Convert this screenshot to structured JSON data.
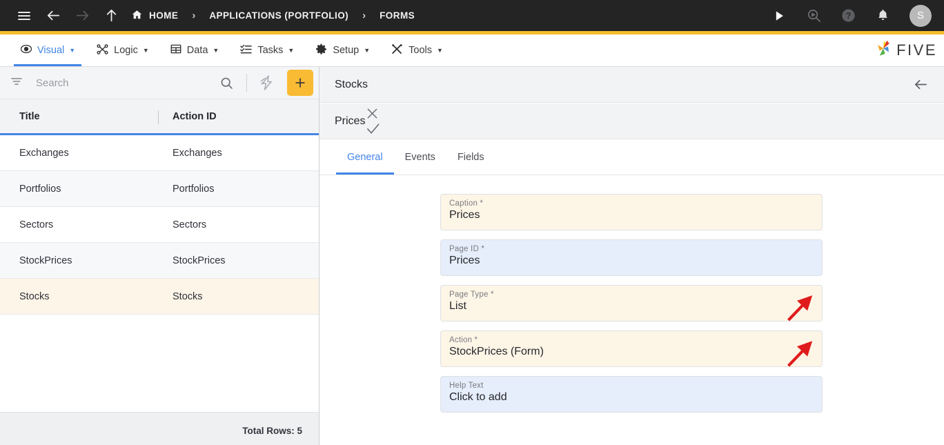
{
  "topbar": {
    "menu_icon": "hamburger-icon",
    "back_icon": "arrow-left-icon",
    "forward_icon": "arrow-right-icon",
    "up_icon": "arrow-up-icon",
    "breadcrumbs": [
      {
        "label": "HOME",
        "icon": "home-icon"
      },
      {
        "label": "APPLICATIONS (PORTFOLIO)",
        "icon": ""
      },
      {
        "label": "FORMS",
        "icon": ""
      }
    ],
    "separator": "›",
    "actions": [
      {
        "name": "run-icon",
        "glyph": "▶"
      },
      {
        "name": "search-run-icon",
        "glyph": ""
      },
      {
        "name": "help-icon",
        "glyph": "?"
      },
      {
        "name": "notifications-bell-icon",
        "glyph": ""
      }
    ],
    "avatar_initial": "S",
    "accent_color": "#f5bc2e"
  },
  "menubar": {
    "items": [
      {
        "label": "Visual",
        "icon": "eye-icon",
        "active": true
      },
      {
        "label": "Logic",
        "icon": "logic-icon",
        "active": false
      },
      {
        "label": "Data",
        "icon": "table-icon",
        "active": false
      },
      {
        "label": "Tasks",
        "icon": "tasks-icon",
        "active": false
      },
      {
        "label": "Setup",
        "icon": "gear-icon",
        "active": false
      },
      {
        "label": "Tools",
        "icon": "tools-icon",
        "active": false
      }
    ],
    "caret": "▼",
    "brand": "FIVE",
    "active_color": "#4285e8"
  },
  "sidebar": {
    "search": {
      "placeholder": "Search",
      "value": "",
      "filter_icon": "filter-icon",
      "search_icon": "search-icon",
      "lightning_icon": "lightning-bolt-icon",
      "add_label": "+",
      "add_color": "#f8bb33"
    },
    "table": {
      "columns": [
        "Title",
        "Action ID"
      ],
      "rows": [
        {
          "title": "Exchanges",
          "action_id": "Exchanges",
          "selected": false
        },
        {
          "title": "Portfolios",
          "action_id": "Portfolios",
          "selected": false
        },
        {
          "title": "Sectors",
          "action_id": "Sectors",
          "selected": false
        },
        {
          "title": "StockPrices",
          "action_id": "StockPrices",
          "selected": false
        },
        {
          "title": "Stocks",
          "action_id": "Stocks",
          "selected": true
        }
      ],
      "footer": "Total Rows: 5"
    }
  },
  "detail": {
    "panel_title": "Stocks",
    "back_icon": "arrow-left-icon",
    "card_title": "Prices",
    "cancel_icon": "close-x-icon",
    "confirm_icon": "checkmark-icon",
    "tabs": [
      {
        "label": "General",
        "active": true
      },
      {
        "label": "Events",
        "active": false
      },
      {
        "label": "Fields",
        "active": false
      }
    ],
    "fields": [
      {
        "label": "Caption *",
        "value": "Prices",
        "tone": "cream",
        "dropdown": false
      },
      {
        "label": "Page ID *",
        "value": "Prices",
        "tone": "blue",
        "dropdown": false
      },
      {
        "label": "Page Type *",
        "value": "List",
        "tone": "cream",
        "dropdown": true
      },
      {
        "label": "Action *",
        "value": "StockPrices (Form)",
        "tone": "cream",
        "dropdown": true
      },
      {
        "label": "Help Text",
        "value": "Click to add",
        "tone": "blue",
        "dropdown": false
      }
    ],
    "annotations": {
      "arrow_color": "#e01b1b",
      "count": 2
    }
  }
}
